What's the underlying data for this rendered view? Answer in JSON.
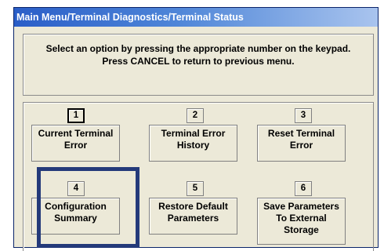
{
  "window": {
    "title": "Main Menu/Terminal Diagnostics/Terminal Status"
  },
  "instructions": {
    "line1": "Select an option by pressing the appropriate number on the keypad.",
    "line2": "Press CANCEL to return to previous menu."
  },
  "options": [
    {
      "number": "1",
      "label_line1": "Current Terminal",
      "label_line2": "Error",
      "label_line3": ""
    },
    {
      "number": "2",
      "label_line1": "Terminal Error",
      "label_line2": "History",
      "label_line3": ""
    },
    {
      "number": "3",
      "label_line1": "Reset Terminal",
      "label_line2": "Error",
      "label_line3": ""
    },
    {
      "number": "4",
      "label_line1": "Configuration",
      "label_line2": "Summary",
      "label_line3": ""
    },
    {
      "number": "5",
      "label_line1": "Restore Default",
      "label_line2": "Parameters",
      "label_line3": ""
    },
    {
      "number": "6",
      "label_line1": "Save Parameters",
      "label_line2": "To External",
      "label_line3": "Storage"
    }
  ],
  "colors": {
    "titlebar_start": "#2a5ec8",
    "window_background": "#ece9d8",
    "highlight_border": "#243a7a"
  }
}
